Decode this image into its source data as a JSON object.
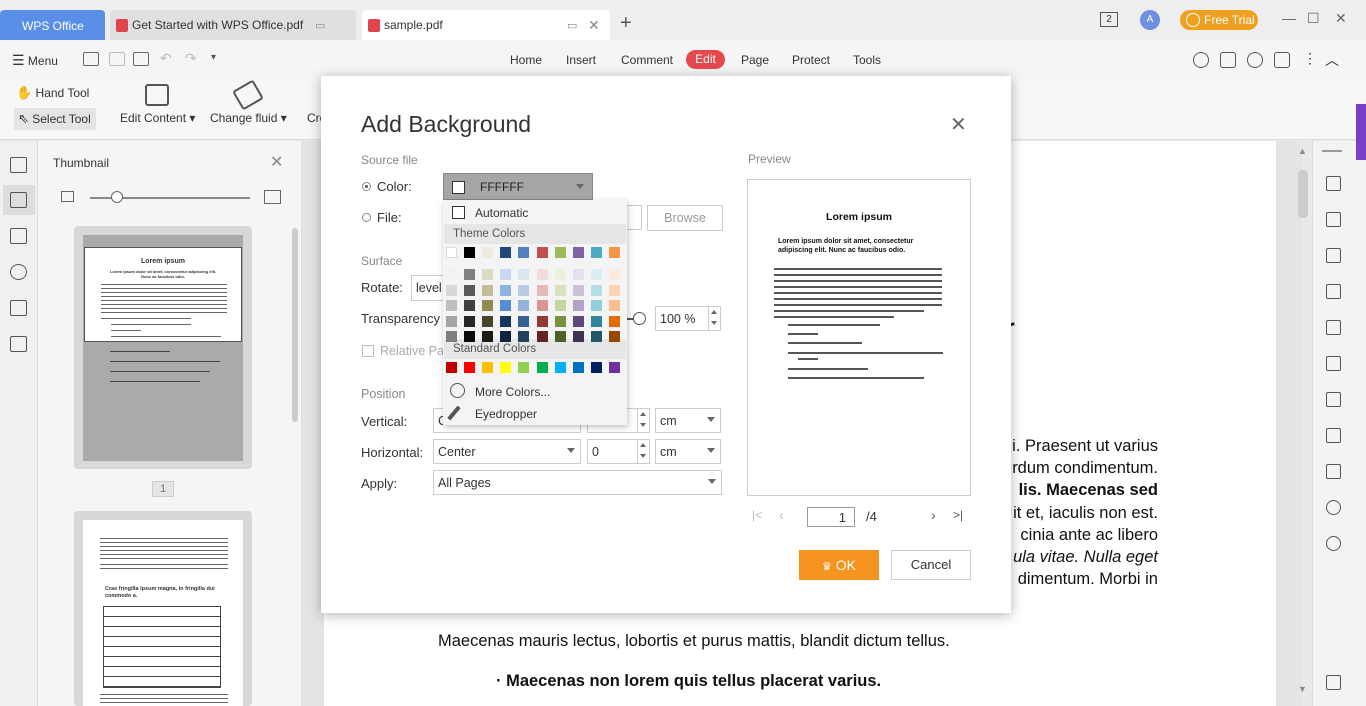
{
  "titlebar": {
    "home_tab": "WPS Office",
    "tabs": [
      {
        "label": "Get Started with WPS Office.pdf"
      },
      {
        "label": "sample.pdf"
      }
    ],
    "free_trial": "Free Trial",
    "avatar": "A",
    "tab_switch_count": "2"
  },
  "menubar": {
    "menu_label": "Menu",
    "tabs": [
      "Home",
      "Insert",
      "Comment",
      "Edit",
      "Page",
      "Protect",
      "Tools"
    ],
    "active_tab": "Edit"
  },
  "ribbon": {
    "hand_tool": "Hand Tool",
    "select_tool": "Select Tool",
    "edit_content": "Edit Content",
    "change_fluid": "Change fluid",
    "cropped": "Cro"
  },
  "thumbnail_panel": {
    "title": "Thumbnail",
    "page1_title": "Lorem ipsum",
    "page1_subtitle": "Lorem ipsum dolor sit amet, consectetur adipiscing elit. Nunc ac faucibus odio.",
    "page2_heading": "Cras fringilla ipsum magna, in fringilla dui commodo a.",
    "page_number": "1"
  },
  "document": {
    "letter_r": "r",
    "lines": [
      "i. Praesent ut varius",
      "rdum condimentum.",
      "lis. Maecenas sed",
      "it et, iaculis non est.",
      "cinia ante ac libero",
      "ula vitae. Nulla eget",
      "dimentum. Morbi in"
    ],
    "para": "Maecenas mauris lectus, lobortis et purus mattis, blandit dictum tellus.",
    "bullet": "· Maecenas non lorem quis tellus placerat varius."
  },
  "dialog": {
    "title": "Add Background",
    "source_file": "Source file",
    "color_label": "Color:",
    "file_label": "File:",
    "color_value": "FFFFFF",
    "browse": "Browse",
    "surface": "Surface",
    "rotate_label": "Rotate:",
    "rotate_value": "level",
    "transparency_label": "Transparency",
    "transparency_value": "100 %",
    "relative_label": "Relative Pa",
    "position": "Position",
    "vertical_label": "Vertical:",
    "vertical_value": "Center",
    "vertical_offset": "0",
    "vertical_unit": "cm",
    "horizontal_label": "Horizontal:",
    "horizontal_value": "Center",
    "horizontal_offset": "0",
    "horizontal_unit": "cm",
    "apply_label": "Apply:",
    "apply_value": "All Pages",
    "preview_label": "Preview",
    "preview_title": "Lorem ipsum",
    "preview_subtitle": "Lorem ipsum dolor sit amet, consectetur adipiscing elit. Nunc ac faucibus odio.",
    "page_current": "1",
    "page_total": "/4",
    "ok": "OK",
    "cancel": "Cancel"
  },
  "color_dropdown": {
    "automatic": "Automatic",
    "theme_colors": "Theme Colors",
    "standard_colors": "Standard Colors",
    "more_colors": "More Colors...",
    "eyedropper": "Eyedropper",
    "theme_top": [
      "#ffffff",
      "#000000",
      "#eeece1",
      "#1f497d",
      "#4f81bd",
      "#c0504d",
      "#9bbb59",
      "#8064a2",
      "#4bacc6",
      "#f79646"
    ],
    "theme_shades": [
      [
        "#f2f2f2",
        "#7f7f7f",
        "#ddd9c3",
        "#c6d9f0",
        "#dbe5f1",
        "#f2dcdb",
        "#ebf1dd",
        "#e5e0ec",
        "#dbeef3",
        "#fdeada"
      ],
      [
        "#d8d8d8",
        "#595959",
        "#c4bd97",
        "#8db3e2",
        "#b8cce4",
        "#e5b9b7",
        "#d7e3bc",
        "#ccc1d9",
        "#b7dde8",
        "#fbd5b5"
      ],
      [
        "#bfbfbf",
        "#3f3f3f",
        "#938953",
        "#548dd4",
        "#95b3d7",
        "#d99694",
        "#c3d69b",
        "#b2a2c7",
        "#92cddc",
        "#fac08f"
      ],
      [
        "#a5a5a5",
        "#262626",
        "#494429",
        "#17365d",
        "#366092",
        "#953734",
        "#76923c",
        "#5f497a",
        "#31859b",
        "#e36c09"
      ],
      [
        "#7f7f7f",
        "#0c0c0c",
        "#1d1b10",
        "#0f243e",
        "#244061",
        "#632423",
        "#4f6128",
        "#3f3151",
        "#205867",
        "#974806"
      ]
    ],
    "standard": [
      "#c00000",
      "#ff0000",
      "#ffc000",
      "#ffff00",
      "#92d050",
      "#00b050",
      "#00b0f0",
      "#0070c0",
      "#002060",
      "#7030a0"
    ]
  }
}
